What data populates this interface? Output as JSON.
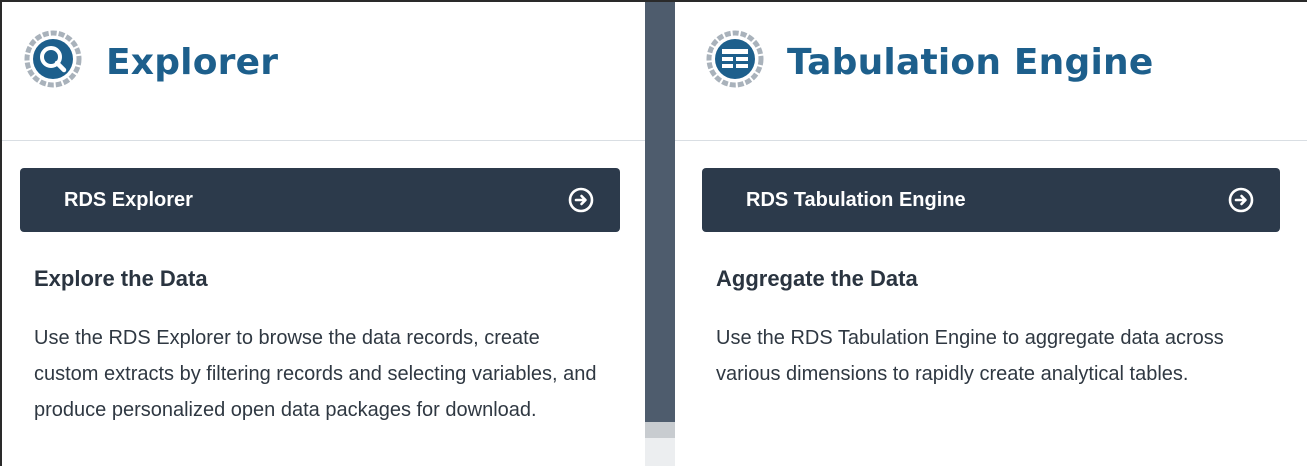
{
  "explorer": {
    "title": "Explorer",
    "icon": "search-magnifier-icon",
    "button_label": "RDS Explorer",
    "subheading": "Explore the Data",
    "description": "Use the RDS Explorer to browse the data records, create custom extracts by filtering records and selecting variables, and produce personalized open data packages for download."
  },
  "tabulation": {
    "title": "Tabulation Engine",
    "icon": "table-icon",
    "button_label": "RDS Tabulation Engine",
    "subheading": "Aggregate the Data",
    "description": "Use the RDS Tabulation Engine to aggregate data across various dimensions to rapidly create analytical tables."
  },
  "colors": {
    "title": "#1d5f8c",
    "button_bg": "#2c3a4b",
    "divider": "#4e5c6d"
  }
}
